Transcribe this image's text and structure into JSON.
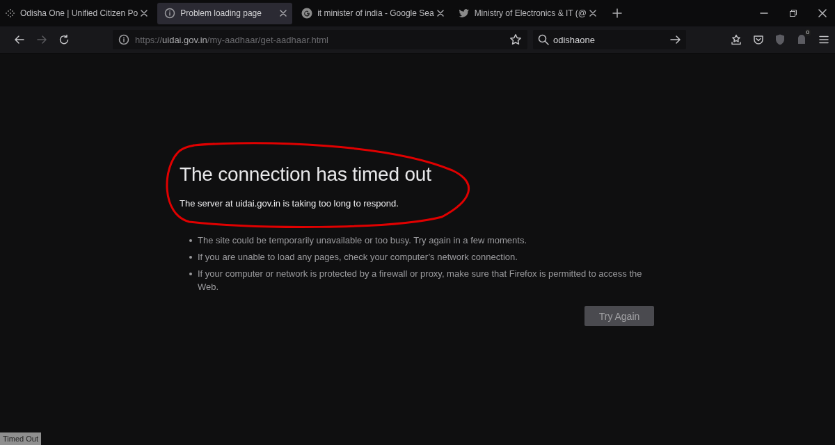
{
  "tabs": [
    {
      "kind": "dots",
      "title": "Odisha One | Unified Citizen Po",
      "selected": false
    },
    {
      "kind": "info",
      "title": "Problem loading page",
      "selected": true
    },
    {
      "kind": "google",
      "title": "it minister of india - Google Sea",
      "selected": false
    },
    {
      "kind": "bird",
      "title": "Ministry of Electronics & IT (@",
      "selected": false
    }
  ],
  "address_bar": {
    "scheme": "https://",
    "domain": "uidai.gov.in",
    "path": "/my-aadhaar/get-aadhaar.html"
  },
  "search": {
    "value": "odishaone"
  },
  "toolbar": {
    "notification_count": "0"
  },
  "error_page": {
    "title": "The connection has timed out",
    "message": "The server at uidai.gov.in is taking too long to respond.",
    "tips": [
      "The site could be temporarily unavailable or too busy. Try again in a few moments.",
      "If you are unable to load any pages, check your computer’s network connection.",
      "If your computer or network is protected by a firewall or proxy, make sure that Firefox is permitted to access the Web."
    ],
    "button": "Try Again"
  },
  "annotation": {
    "kind": "freehand-loop",
    "color": "#e00000"
  },
  "status_bar": "Timed Out"
}
